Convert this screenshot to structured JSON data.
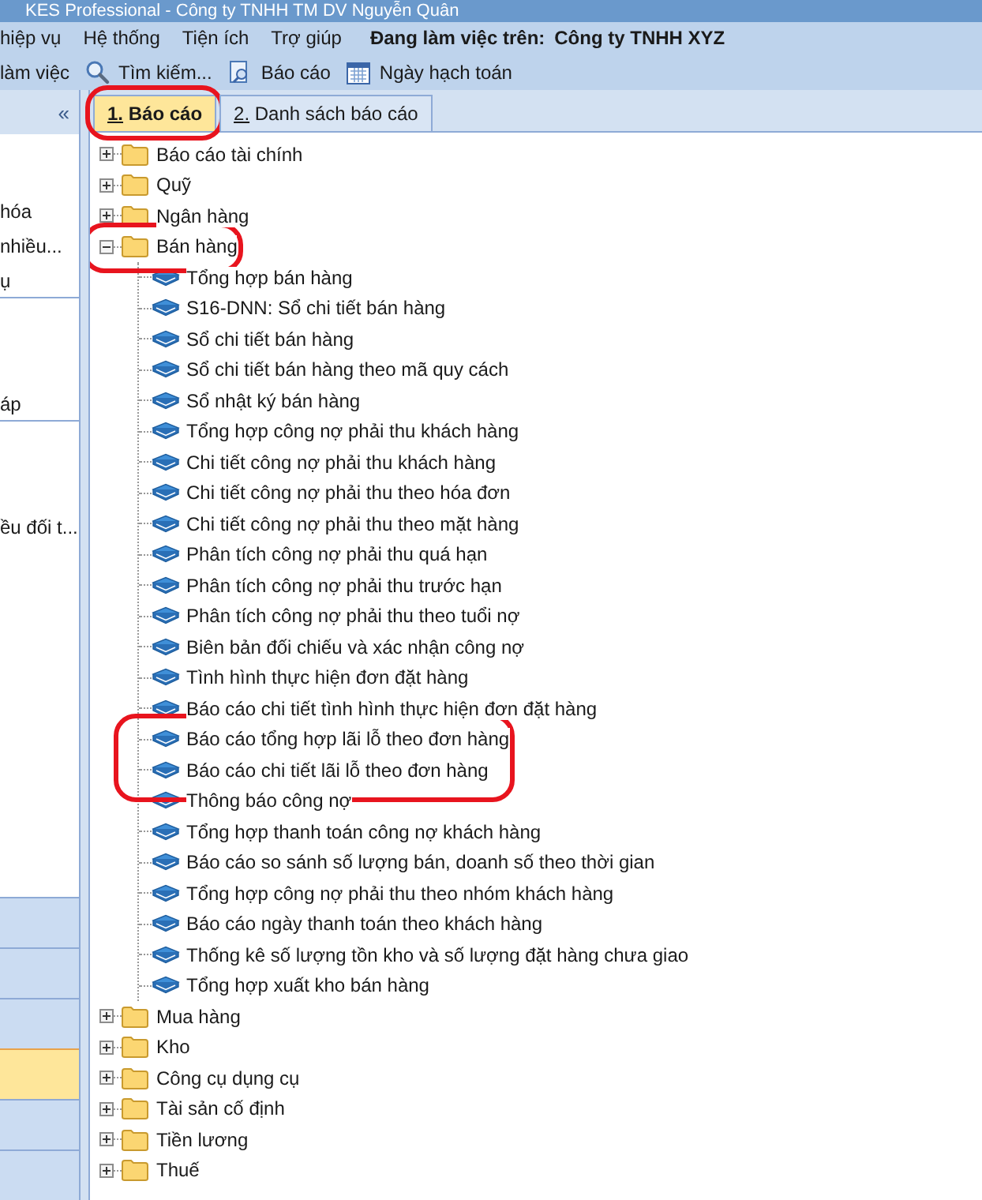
{
  "window": {
    "title": "KES Professional - Công ty TNHH TM DV Nguyễn Quân"
  },
  "menu": {
    "items": [
      "hiệp vụ",
      "Hệ thống",
      "Tiện ích",
      "Trợ giúp"
    ],
    "status_label": "Đang làm việc trên:",
    "company": "Công ty TNHH XYZ"
  },
  "toolbar": [
    {
      "kind": "text",
      "label": "làm việc"
    },
    {
      "kind": "search",
      "label": "Tìm kiếm..."
    },
    {
      "kind": "report",
      "label": "Báo cáo"
    },
    {
      "kind": "calendar",
      "label": "Ngày hạch toán"
    }
  ],
  "left_panel": {
    "collapse": "«",
    "items": [
      {
        "text": "hóa",
        "divider": false
      },
      {
        "text": "nhiều...",
        "divider": false
      },
      {
        "text": "ụ",
        "divider": true
      },
      {
        "text": "áp",
        "divider": true
      },
      {
        "text": "ều đối t...",
        "divider": false
      }
    ],
    "nav_bars": [
      {
        "selected": false
      },
      {
        "selected": false
      },
      {
        "selected": false
      },
      {
        "selected": true
      },
      {
        "selected": false
      },
      {
        "selected": false
      }
    ]
  },
  "tabs": [
    {
      "label": "1. Báo cáo",
      "selected": true,
      "circled": true
    },
    {
      "label": "2. Danh sách báo cáo",
      "selected": false,
      "circled": false
    }
  ],
  "tree": [
    {
      "label": "Báo cáo tài chính",
      "expanded": false,
      "circled": false
    },
    {
      "label": "Quỹ",
      "expanded": false,
      "circled": false
    },
    {
      "label": "Ngân hàng",
      "expanded": false,
      "circled": false
    },
    {
      "label": "Bán hàng",
      "expanded": true,
      "circled": true,
      "children": [
        {
          "label": "Tổng hợp bán hàng",
          "circled": false
        },
        {
          "label": "S16-DNN: Sổ chi tiết bán hàng",
          "circled": false
        },
        {
          "label": "Sổ chi tiết bán hàng",
          "circled": false
        },
        {
          "label": "Sổ chi tiết bán hàng theo mã quy cách",
          "circled": false
        },
        {
          "label": "Sổ nhật ký bán hàng",
          "circled": false
        },
        {
          "label": "Tổng hợp công nợ phải thu khách hàng",
          "circled": false
        },
        {
          "label": "Chi tiết công nợ phải thu khách hàng",
          "circled": false
        },
        {
          "label": "Chi tiết công nợ phải thu theo hóa đơn",
          "circled": false
        },
        {
          "label": "Chi tiết công nợ phải thu theo mặt hàng",
          "circled": false
        },
        {
          "label": "Phân tích công nợ phải thu quá hạn",
          "circled": false
        },
        {
          "label": "Phân tích công nợ phải thu trước hạn",
          "circled": false
        },
        {
          "label": "Phân tích công nợ phải thu theo tuổi nợ",
          "circled": false
        },
        {
          "label": "Biên bản đối chiếu và xác nhận công nợ",
          "circled": false
        },
        {
          "label": "Tình hình thực hiện đơn đặt hàng",
          "circled": false
        },
        {
          "label": "Báo cáo chi tiết tình hình thực hiện đơn đặt hàng",
          "circled": false
        },
        {
          "label": "Báo cáo tổng hợp lãi lỗ theo đơn hàng",
          "circled": true
        },
        {
          "label": "Báo cáo chi tiết lãi lỗ theo đơn hàng",
          "circled": true
        },
        {
          "label": "Thông báo công nợ",
          "circled": false
        },
        {
          "label": "Tổng hợp thanh toán công nợ khách hàng",
          "circled": false
        },
        {
          "label": "Báo cáo so sánh số lượng bán, doanh số theo thời gian",
          "circled": false
        },
        {
          "label": "Tổng hợp công nợ phải thu theo nhóm khách hàng",
          "circled": false
        },
        {
          "label": "Báo cáo ngày thanh toán theo khách hàng",
          "circled": false
        },
        {
          "label": "Thống kê số lượng tồn kho và số lượng đặt hàng chưa giao",
          "circled": false
        },
        {
          "label": "Tổng hợp xuất kho bán hàng",
          "circled": false
        }
      ]
    },
    {
      "label": "Mua hàng",
      "expanded": false,
      "circled": false
    },
    {
      "label": "Kho",
      "expanded": false,
      "circled": false
    },
    {
      "label": "Công cụ dụng cụ",
      "expanded": false,
      "circled": false
    },
    {
      "label": "Tài sản cố định",
      "expanded": false,
      "circled": false
    },
    {
      "label": "Tiền lương",
      "expanded": false,
      "circled": false
    },
    {
      "label": "Thuế",
      "expanded": false,
      "circled": false
    }
  ]
}
